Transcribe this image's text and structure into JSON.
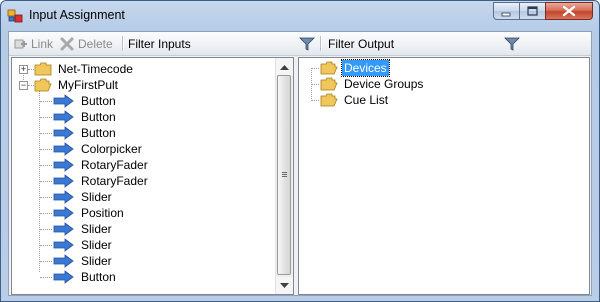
{
  "window": {
    "title": "Input Assignment"
  },
  "toolbar": {
    "link_label": "Link",
    "delete_label": "Delete",
    "filter_inputs_label": "Filter Inputs",
    "filter_output_label": "Filter Output"
  },
  "inputs_tree": {
    "nodes": [
      {
        "label": "Net-Timecode",
        "icon": "folder-icon",
        "expanded": false
      },
      {
        "label": "MyFirstPult",
        "icon": "folder-icon",
        "expanded": true,
        "children": [
          "Button",
          "Button",
          "Button",
          "Colorpicker",
          "RotaryFader",
          "RotaryFader",
          "Slider",
          "Position",
          "Slider",
          "Slider",
          "Slider",
          "Button"
        ]
      }
    ]
  },
  "output_tree": {
    "nodes": [
      {
        "label": "Devices",
        "icon": "folder-icon",
        "selected": true
      },
      {
        "label": "Device Groups",
        "icon": "folder-icon",
        "selected": false
      },
      {
        "label": "Cue List",
        "icon": "folder-icon",
        "selected": false
      }
    ]
  },
  "colors": {
    "selection": "#3399ff",
    "arrow": "#3a7ad6",
    "folder": "#f1c75c"
  }
}
